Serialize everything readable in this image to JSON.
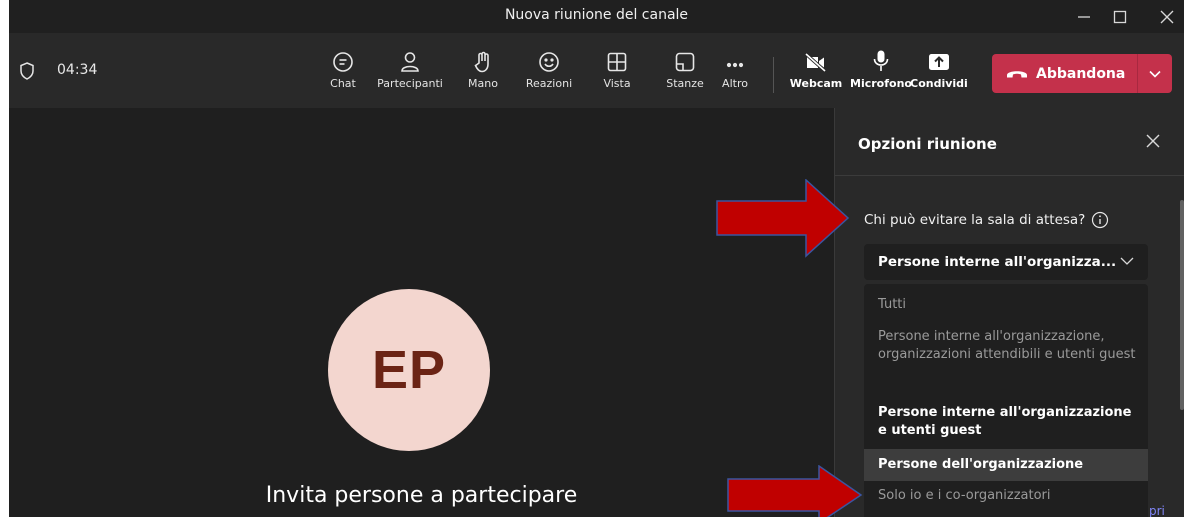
{
  "window": {
    "title": "Nuova riunione del canale"
  },
  "toolbar": {
    "timer": "04:34",
    "buttons": [
      {
        "label": "Chat",
        "icon": "chat-icon"
      },
      {
        "label": "Partecipanti",
        "icon": "people-icon"
      },
      {
        "label": "Mano",
        "icon": "raise-hand-icon"
      },
      {
        "label": "Reazioni",
        "icon": "smiley-icon"
      },
      {
        "label": "Vista",
        "icon": "layout-icon"
      },
      {
        "label": "Stanze",
        "icon": "breakout-rooms-icon"
      },
      {
        "label": "Altro",
        "icon": "more-icon"
      },
      {
        "label": "Webcam",
        "icon": "camera-off-icon"
      },
      {
        "label": "Microfono",
        "icon": "microphone-icon"
      },
      {
        "label": "Condividi",
        "icon": "share-icon"
      }
    ],
    "leave_label": "Abbandona"
  },
  "stage": {
    "avatar_initials": "EP",
    "invite_text": "Invita persone a partecipare"
  },
  "panel": {
    "title": "Opzioni riunione",
    "question": "Chi può evitare la sala di attesa?",
    "selected_value": "Persone interne all'organizza...",
    "options": [
      "Tutti",
      "Persone interne all'organizzazione, organizzazioni attendibili e utenti guest",
      "Persone interne all'organizzazione e utenti guest",
      "Persone dell'organizzazione",
      "Solo io e i co-organizzatori"
    ],
    "partial_link_text": "pri"
  },
  "colors": {
    "accent_red": "#c4314b",
    "annotation_arrow": "#c00000",
    "avatar_bg": "#f3d6cf",
    "avatar_text": "#6b2415"
  }
}
